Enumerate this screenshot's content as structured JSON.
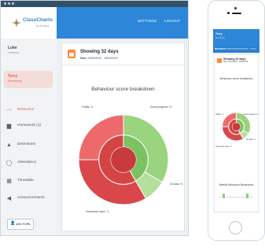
{
  "window": {
    "title_dots": 3
  },
  "brand": {
    "name": "ClassCharts",
    "tagline": "by Edukey"
  },
  "header": {
    "links": [
      "SETTINGS",
      "LOGOUT"
    ]
  },
  "pupils": [
    {
      "name": "Luke",
      "subtitle": "Johnson",
      "active": false
    },
    {
      "name": "Terry",
      "subtitle": "Armstrong",
      "active": true
    }
  ],
  "nav": [
    {
      "label": "Behaviour",
      "icon": "behaviour-icon",
      "active": true
    },
    {
      "label": "Homework (1)",
      "icon": "homework-icon",
      "active": false
    },
    {
      "label": "Detentions",
      "icon": "detentions-icon",
      "active": false
    },
    {
      "label": "Attendance",
      "icon": "attendance-icon",
      "active": false
    },
    {
      "label": "Timetable",
      "icon": "timetable-icon",
      "active": false
    },
    {
      "label": "Announcements",
      "icon": "announcements-icon",
      "active": false
    }
  ],
  "add_pupil_label": "ADD PUPIL",
  "summary": {
    "title": "Showing 32 days",
    "date_prefix": "Date:",
    "date_range": "15/03/2019 - 16/04/2019"
  },
  "colors": {
    "accent": "#2d86d8",
    "positive": "#8fd07e",
    "negative": "#e8585a",
    "orange": "#ff8a35"
  },
  "chart_data": {
    "type": "pie",
    "title": "Behaviour score breakdown",
    "style": "sunburst",
    "slices": [
      {
        "label": "Good progress",
        "value": 4,
        "display": "Good progress +4",
        "group": "positive"
      },
      {
        "label": "On-task",
        "value": 1,
        "display": "On-task +1",
        "group": "positive"
      },
      {
        "label": "Homework issue",
        "value": 3,
        "display": "Homework issue -3",
        "group": "negative"
      },
      {
        "label": "Chatty",
        "value": 4,
        "display": "Chatty -4",
        "group": "negative"
      }
    ]
  },
  "phone": {
    "pupil_name": "Terry",
    "pupil_subtitle": "Armstrong",
    "tabs": [
      "BEHAVIOUR",
      "HOMEWORK",
      "DETENTIONS",
      "ATTEN"
    ],
    "summary_title": "Showing 32 days",
    "summary_date": "Date: 15/03/2019 - 16/04/2019",
    "chart_title": "Behaviour score breakdown",
    "labels": [
      "Chatty -4",
      "Good progress +4",
      "On-task +1",
      "Homework issue -3"
    ],
    "weekly_title": "Weekly Behaviour Breakdown"
  }
}
